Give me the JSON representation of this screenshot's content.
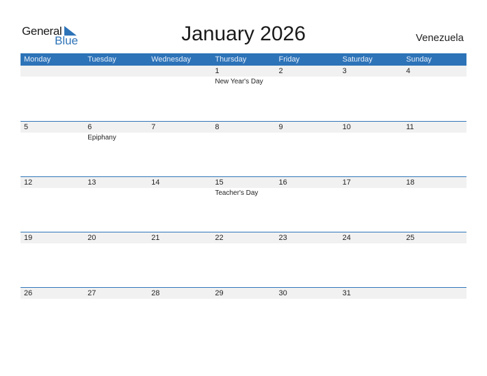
{
  "logo": {
    "general": "General",
    "blue": "Blue"
  },
  "title": "January 2026",
  "country": "Venezuela",
  "weekdays": [
    "Monday",
    "Tuesday",
    "Wednesday",
    "Thursday",
    "Friday",
    "Saturday",
    "Sunday"
  ],
  "weeks": [
    {
      "days": [
        "",
        "",
        "",
        "1",
        "2",
        "3",
        "4"
      ],
      "events": [
        "",
        "",
        "",
        "New Year's Day",
        "",
        "",
        ""
      ]
    },
    {
      "days": [
        "5",
        "6",
        "7",
        "8",
        "9",
        "10",
        "11"
      ],
      "events": [
        "",
        "Epiphany",
        "",
        "",
        "",
        "",
        ""
      ]
    },
    {
      "days": [
        "12",
        "13",
        "14",
        "15",
        "16",
        "17",
        "18"
      ],
      "events": [
        "",
        "",
        "",
        "Teacher's Day",
        "",
        "",
        ""
      ]
    },
    {
      "days": [
        "19",
        "20",
        "21",
        "22",
        "23",
        "24",
        "25"
      ],
      "events": [
        "",
        "",
        "",
        "",
        "",
        "",
        ""
      ]
    },
    {
      "days": [
        "26",
        "27",
        "28",
        "29",
        "30",
        "31",
        ""
      ],
      "events": [
        "",
        "",
        "",
        "",
        "",
        "",
        ""
      ]
    }
  ],
  "colors": {
    "accent": "#2d73b8",
    "band": "#f1f1f1"
  }
}
